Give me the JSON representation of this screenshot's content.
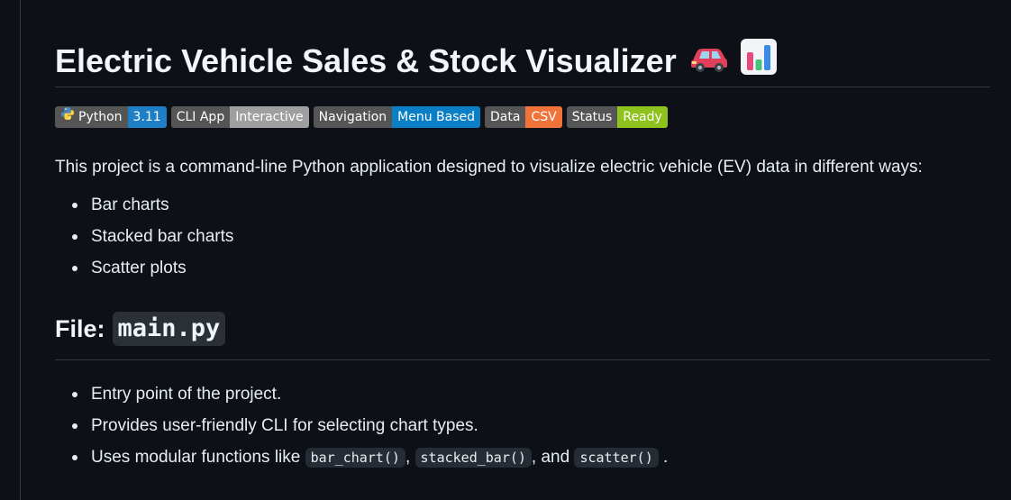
{
  "header": {
    "title": "Electric Vehicle Sales & Stock Visualizer",
    "emoji_icons": [
      "car-icon",
      "bar-chart-icon"
    ]
  },
  "badges": [
    {
      "label": "Python",
      "value": "3.11",
      "color": "#1f7fc6",
      "icon": "python-logo-icon"
    },
    {
      "label": "CLI App",
      "value": "Interactive",
      "color": "#9f9f9f"
    },
    {
      "label": "Navigation",
      "value": "Menu Based",
      "color": "#0b7fc6"
    },
    {
      "label": "Data",
      "value": "CSV",
      "color": "#f1733a"
    },
    {
      "label": "Status",
      "value": "Ready",
      "color": "#8ec31d"
    }
  ],
  "intro": "This project is a command-line Python application designed to visualize electric vehicle (EV) data in different ways:",
  "chart_types": [
    "Bar charts",
    "Stacked bar charts",
    "Scatter plots"
  ],
  "file_section": {
    "heading_prefix": "File:",
    "filename": "main.py",
    "items": [
      "Entry point of the project.",
      "Provides user-friendly CLI for selecting chart types."
    ],
    "modular_line": {
      "prefix": "Uses modular functions like",
      "fn1": "bar_chart()",
      "sep1": ",",
      "fn2": "stacked_bar()",
      "sep2": ", and",
      "fn3": "scatter()",
      "suffix": "."
    }
  }
}
